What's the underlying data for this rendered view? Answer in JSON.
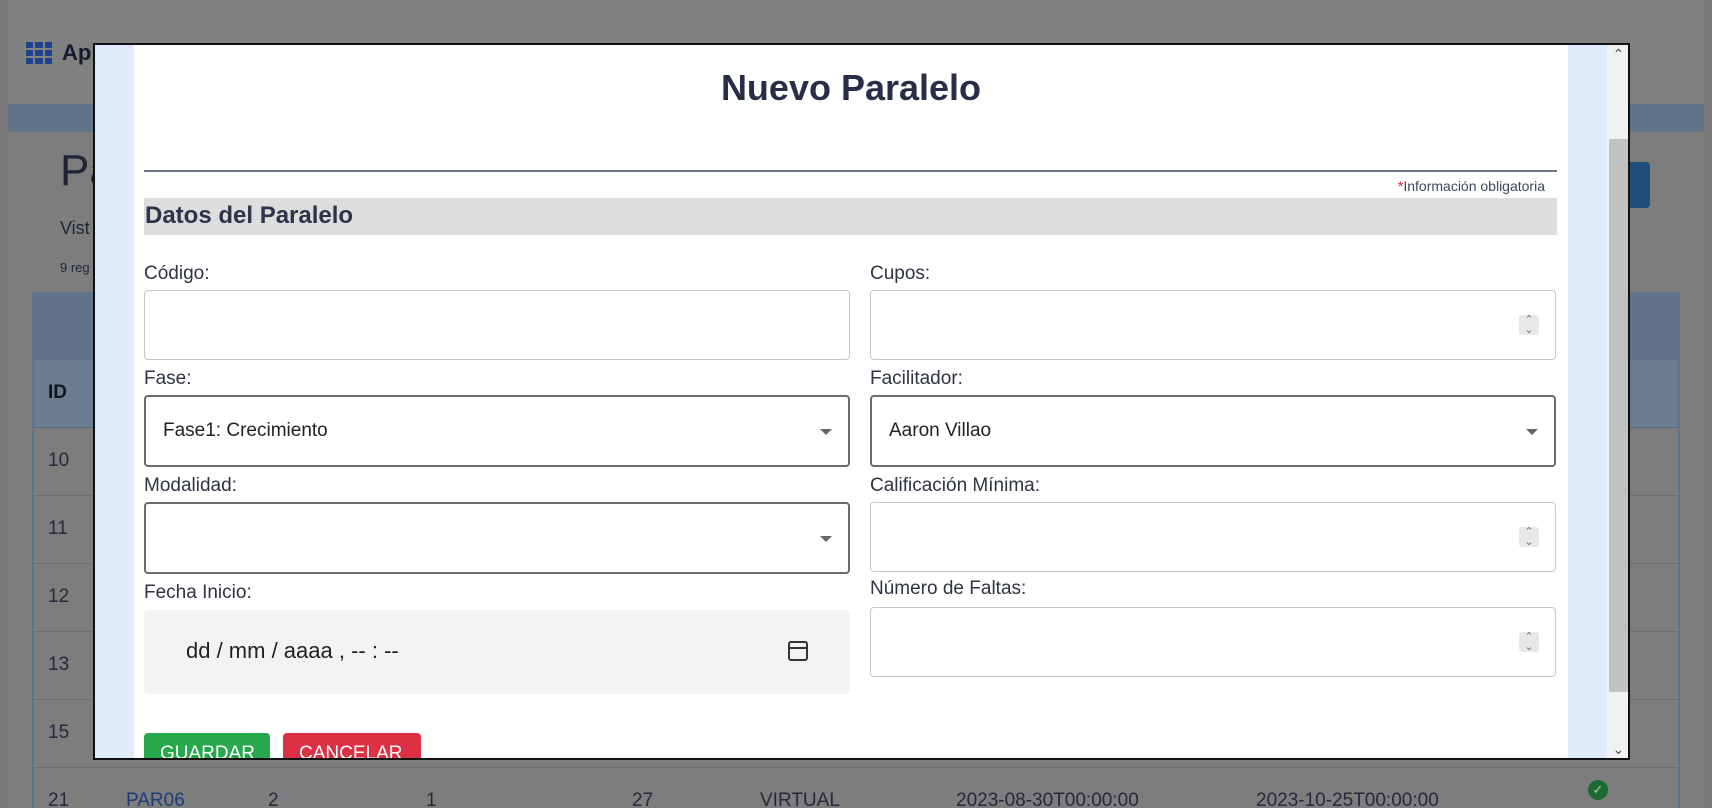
{
  "background": {
    "app_title": "Ap",
    "page_title": "Pa",
    "page_subtitle": "Vist",
    "record_count": "9 reg",
    "table": {
      "id_header": "ID",
      "rows": [
        {
          "id": "10"
        },
        {
          "id": "11"
        },
        {
          "id": "12"
        },
        {
          "id": "13"
        },
        {
          "id": "15"
        },
        {
          "id": "21",
          "codigo": "PAR06",
          "c2": "2",
          "c3": "1",
          "c4": "27",
          "modalidad": "VIRTUAL",
          "inicio": "2023-08-30T00:00:00",
          "fin": "2023-10-25T00:00:00"
        }
      ]
    }
  },
  "modal": {
    "title": "Nuevo Paralelo",
    "required_star": "*",
    "required_note": "Información obligatoria",
    "section_title": "Datos del Paralelo",
    "fields": {
      "codigo": {
        "label": "Código:",
        "value": ""
      },
      "cupos": {
        "label": "Cupos:",
        "value": ""
      },
      "fase": {
        "label": "Fase:",
        "value": "Fase1: Crecimiento"
      },
      "facilitador": {
        "label": "Facilitador:",
        "value": "Aaron Villao"
      },
      "modalidad": {
        "label": "Modalidad:",
        "value": ""
      },
      "calificacion": {
        "label": "Calificación Mínima:",
        "value": ""
      },
      "fecha_inicio": {
        "label": "Fecha Inicio:",
        "value": "dd / mm / aaaa ,  -- : --"
      },
      "faltas": {
        "label": "Número de Faltas:",
        "value": ""
      }
    },
    "buttons": {
      "save": "GUARDAR",
      "cancel": "CANCELAR"
    },
    "icons": {
      "date_picker": "calendar-icon",
      "dropdown": "chevron-down-icon",
      "stepper": "spinner-icon"
    },
    "colors": {
      "save": "#27a84d",
      "cancel": "#dc3144",
      "required": "#e21c36",
      "rail": "#ddebfb"
    }
  }
}
